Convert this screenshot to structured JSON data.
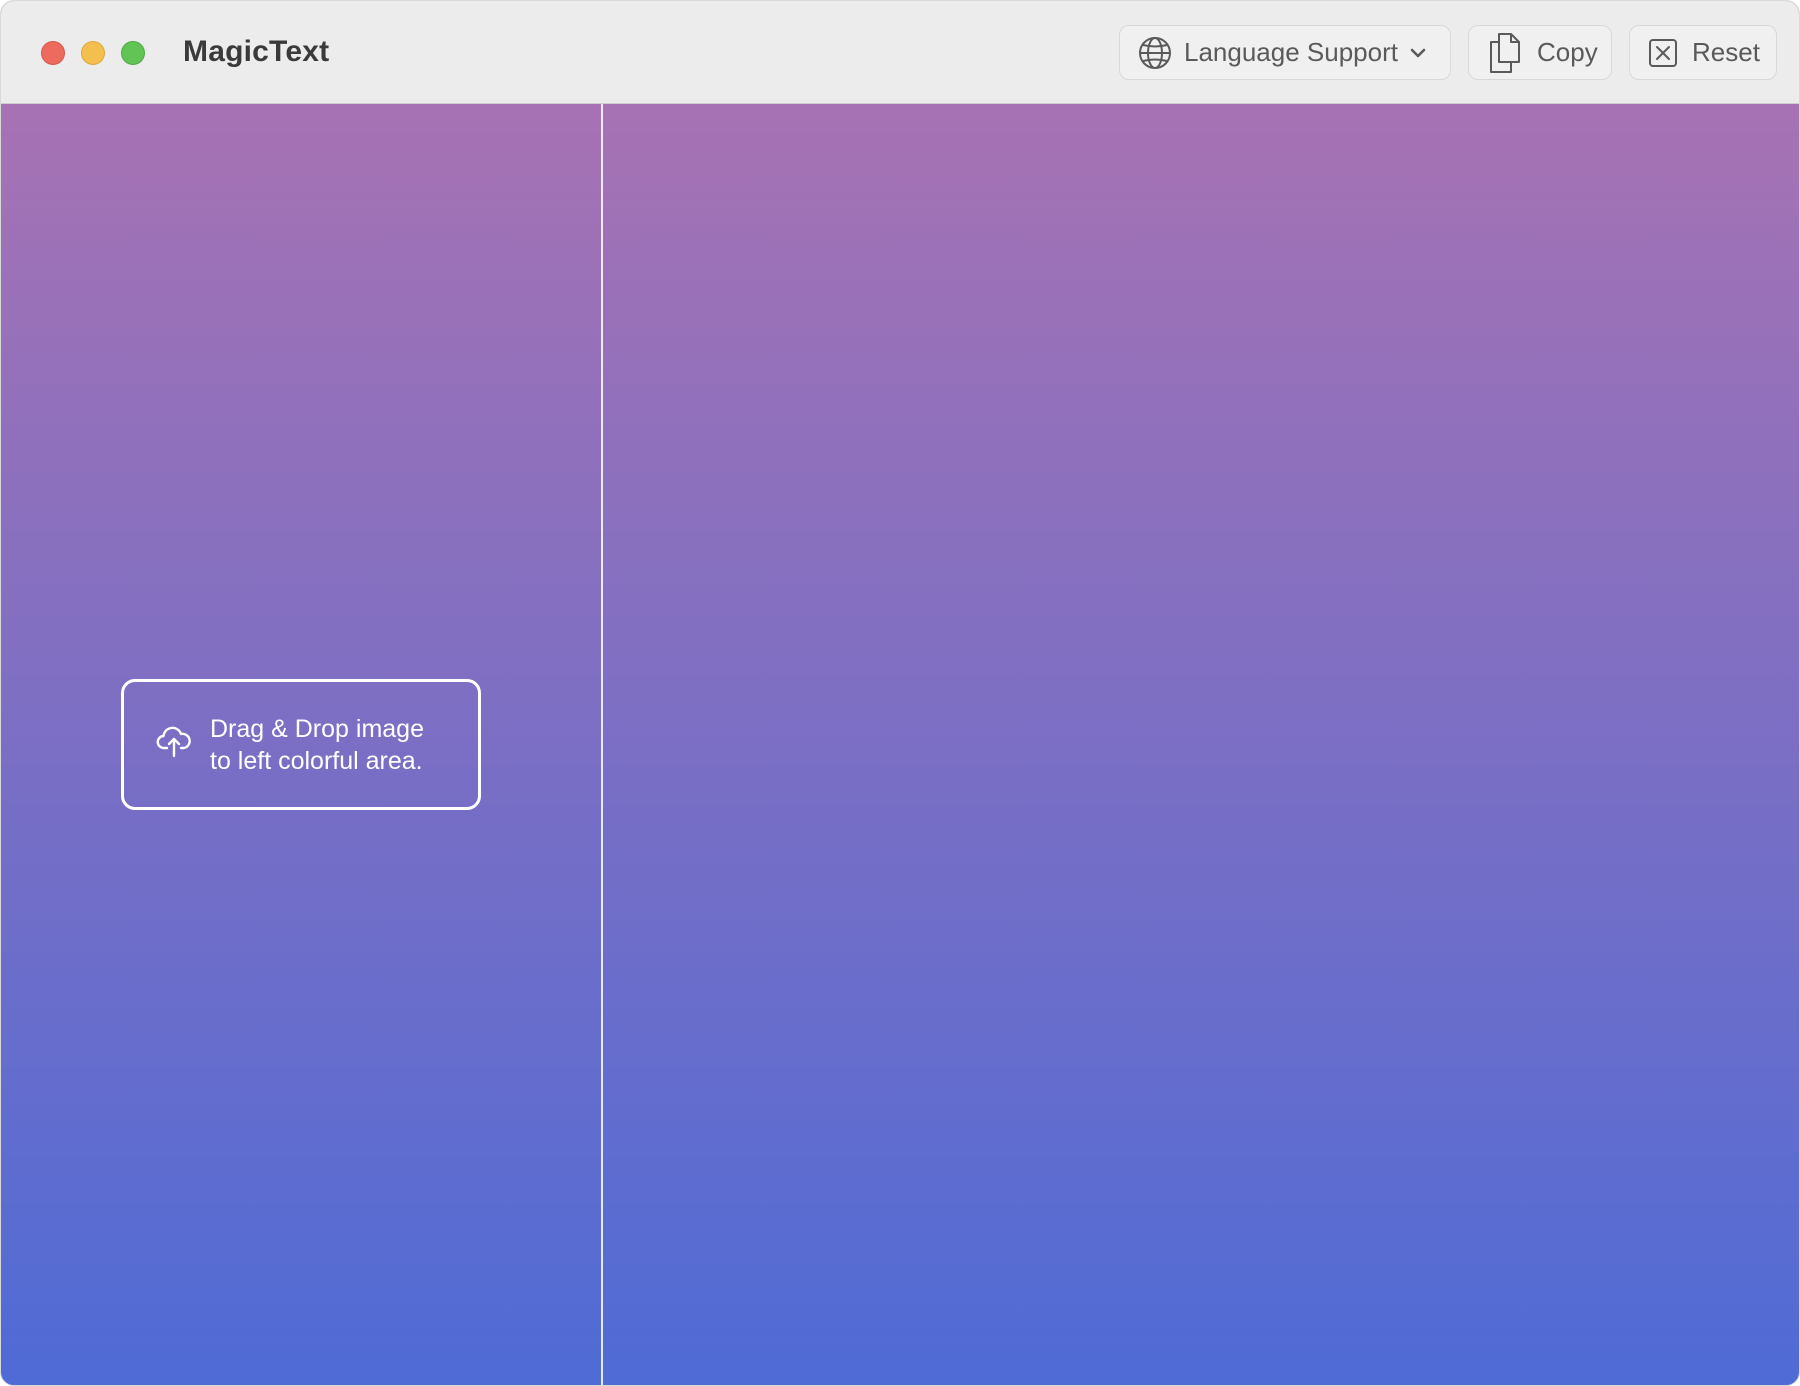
{
  "window": {
    "title": "MagicText"
  },
  "toolbar": {
    "language_label": "Language Support",
    "copy_label": "Copy",
    "reset_label": "Reset"
  },
  "drop_zone": {
    "line1": "Drag & Drop image",
    "line2": "to left colorful area."
  },
  "icons": {
    "language": "globe-icon",
    "language_dropdown": "chevron-down-icon",
    "copy": "copy-documents-icon",
    "reset": "x-square-icon",
    "upload": "cloud-upload-icon"
  },
  "colors": {
    "gradient_top": "#a672b3",
    "gradient_bottom": "#4f6bd6",
    "close": "#ed6a5e",
    "minimize": "#f5bf4f",
    "zoom": "#61c454"
  }
}
